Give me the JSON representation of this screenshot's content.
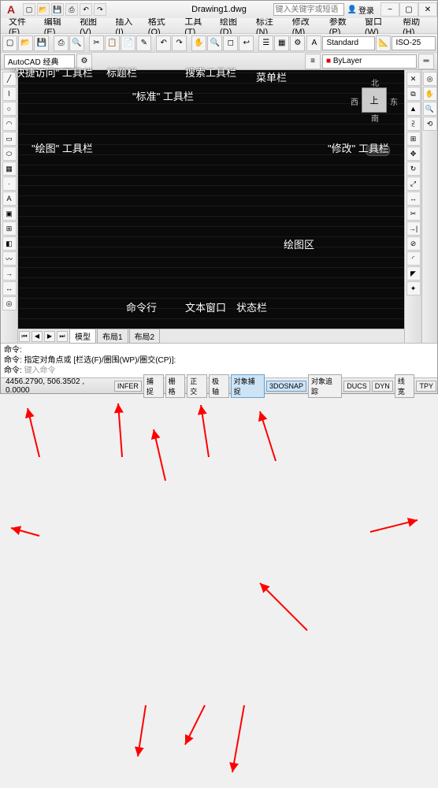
{
  "title": "Drawing1.dwg",
  "search": {
    "placeholder": "键入关键字或短语"
  },
  "login": {
    "label": "登录"
  },
  "menu": [
    "文件(F)",
    "编辑(E)",
    "视图(V)",
    "插入(I)",
    "格式(O)",
    "工具(T)",
    "绘图(D)",
    "标注(N)",
    "修改(M)",
    "参数(P)",
    "窗口(W)",
    "帮助(H)"
  ],
  "workspace": {
    "label": "AutoCAD 经典"
  },
  "styleCombo": "Standard",
  "isoCombo": "ISO-25",
  "layerCombo": "ByLayer",
  "viewcube": {
    "face": "上",
    "n": "北",
    "s": "南",
    "e": "东",
    "w": "西"
  },
  "wcs": "WCS",
  "modelTabs": {
    "model": "模型",
    "layout1": "布局1",
    "layout2": "布局2"
  },
  "cmd": {
    "l1": "命令:",
    "l2": "命令: 指定对角点或 [栏选(F)/圏围(WP)/圏交(CP)]:",
    "prompt": "命令:",
    "input": "键入命令"
  },
  "status": {
    "coord": "4456.2790, 506.3502 , 0.0000",
    "buttons": [
      "INFER",
      "捕捉",
      "栅格",
      "正交",
      "极轴",
      "对象捕捉",
      "3DOSNAP",
      "对象追踪",
      "DUCS",
      "DYN",
      "线宽",
      "TPY"
    ]
  },
  "annotations": {
    "qat": "\"快捷访问\" 工具栏",
    "titlebar": "标题栏",
    "standard": "\"标准\" 工具栏",
    "search": "搜索工具栏",
    "menubar": "菜单栏",
    "draw": "\"绘图\" 工具栏",
    "modify": "\"修改\" 工具栏",
    "canvas": "绘图区",
    "textwin": "文本窗口",
    "cmdline": "命令行",
    "status": "状态栏"
  }
}
